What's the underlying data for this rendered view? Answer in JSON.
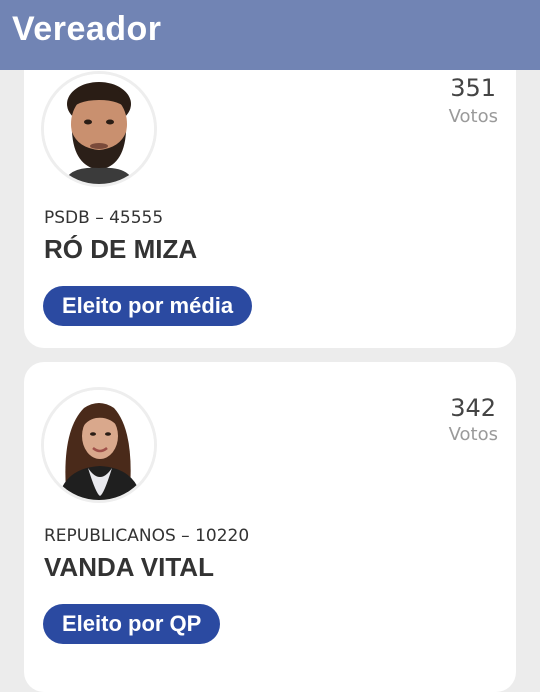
{
  "header": {
    "title": "Vereador"
  },
  "candidates": [
    {
      "votes": "351",
      "votes_label": "Votos",
      "party_number": "PSDB – 45555",
      "name": "RÓ DE MIZA",
      "status": "Eleito por média",
      "photo": "candidate-photo"
    },
    {
      "votes": "342",
      "votes_label": "Votos",
      "party_number": "REPUBLICANOS – 10220",
      "name": "VANDA VITAL",
      "status": "Eleito por QP",
      "photo": "candidate-photo"
    }
  ],
  "colors": {
    "header_bg": "#7184b4",
    "badge_bg": "#2b4aa1",
    "page_bg": "#ececec",
    "card_bg": "#ffffff"
  }
}
